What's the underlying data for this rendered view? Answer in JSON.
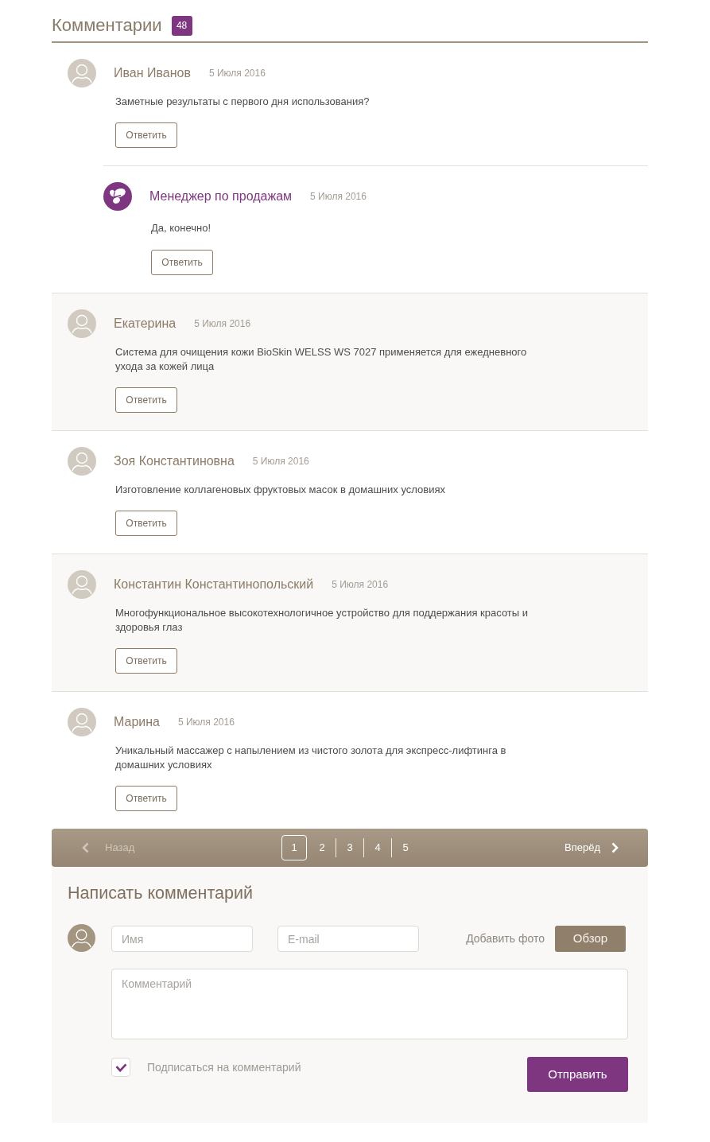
{
  "header": {
    "title": "Комментарии",
    "count": "48"
  },
  "comments": [
    {
      "kind": "user",
      "author": "Иван Иванов",
      "date": "5 Июля 2016",
      "text": "Заметные результаты с первого дня использования?",
      "reply_button": "Ответить",
      "children": [
        {
          "kind": "manager",
          "author": "Менеджер по продажам",
          "date": "5 Июля 2016",
          "text": "Да, конечно!",
          "reply_button": "Ответить"
        }
      ]
    },
    {
      "kind": "user",
      "author": "Екатерина",
      "date": "5 Июля 2016",
      "text": "Система для очищения кожи BioSkin WELSS WS 7027 применяется для ежедневного ухода за кожей лица",
      "reply_button": "Ответить"
    },
    {
      "kind": "user",
      "author": "Зоя Константиновна",
      "date": "5 Июля 2016",
      "text": "Изготовление коллагеновых фруктовых масок в домашних условиях",
      "reply_button": "Ответить"
    },
    {
      "kind": "user",
      "author": "Константин Константинопольский",
      "date": "5 Июля 2016",
      "text": "Многофункциональное высокотехнологичное устройство для поддержания красоты и здоровья глаз",
      "reply_button": "Ответить"
    },
    {
      "kind": "user",
      "author": "Марина",
      "date": "5 Июля 2016",
      "text": "Уникальный массажер с напылением из чистого золота для экспресс-лифтинга в домашних условиях",
      "reply_button": "Ответить"
    }
  ],
  "pagination": {
    "prev": {
      "label": "Назад",
      "disabled": true
    },
    "pages": [
      {
        "label": "1",
        "selected": true
      },
      {
        "label": "2",
        "selected": false
      },
      {
        "label": "3",
        "selected": false
      },
      {
        "label": "4",
        "selected": false
      },
      {
        "label": "5",
        "selected": false
      }
    ],
    "next": {
      "label": "Вперёд",
      "disabled": false
    }
  },
  "form": {
    "title": "Написать комментарий",
    "name_field": {
      "placeholder": "Имя"
    },
    "email_field": {
      "placeholder": "E-mail"
    },
    "photo_label": "Добавить фото",
    "browse_button": "Обзор",
    "comment_field": {
      "placeholder": "Комментарий"
    },
    "subscribe": {
      "label": "Подписаться на комментарий",
      "checked": true
    },
    "submit_button": "Отправить"
  }
}
